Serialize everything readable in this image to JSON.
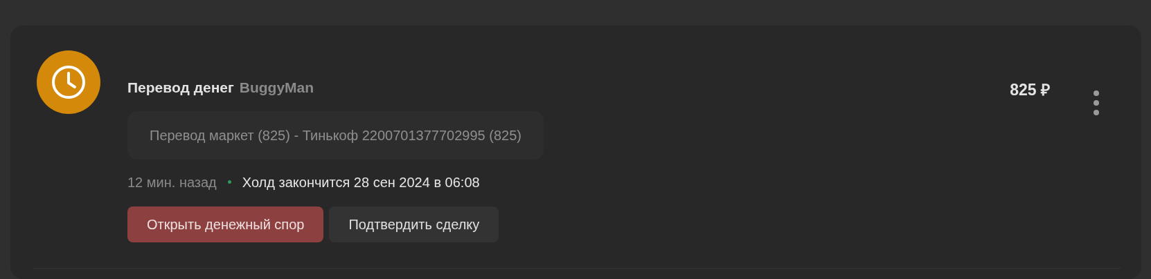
{
  "transaction": {
    "title": "Перевод денег",
    "user": "BuggyMan",
    "amount": "825 ₽",
    "note": "Перевод маркет (825) - Тинькоф 2200701377702995 (825)",
    "time": "12 мин. назад",
    "hold": "Холд закончится 28 сен 2024 в 06:08",
    "buttons": [
      {
        "label": "Открыть денежный спор",
        "kind": "danger"
      },
      {
        "label": "Подтвердить сделку",
        "kind": "secondary"
      }
    ]
  }
}
